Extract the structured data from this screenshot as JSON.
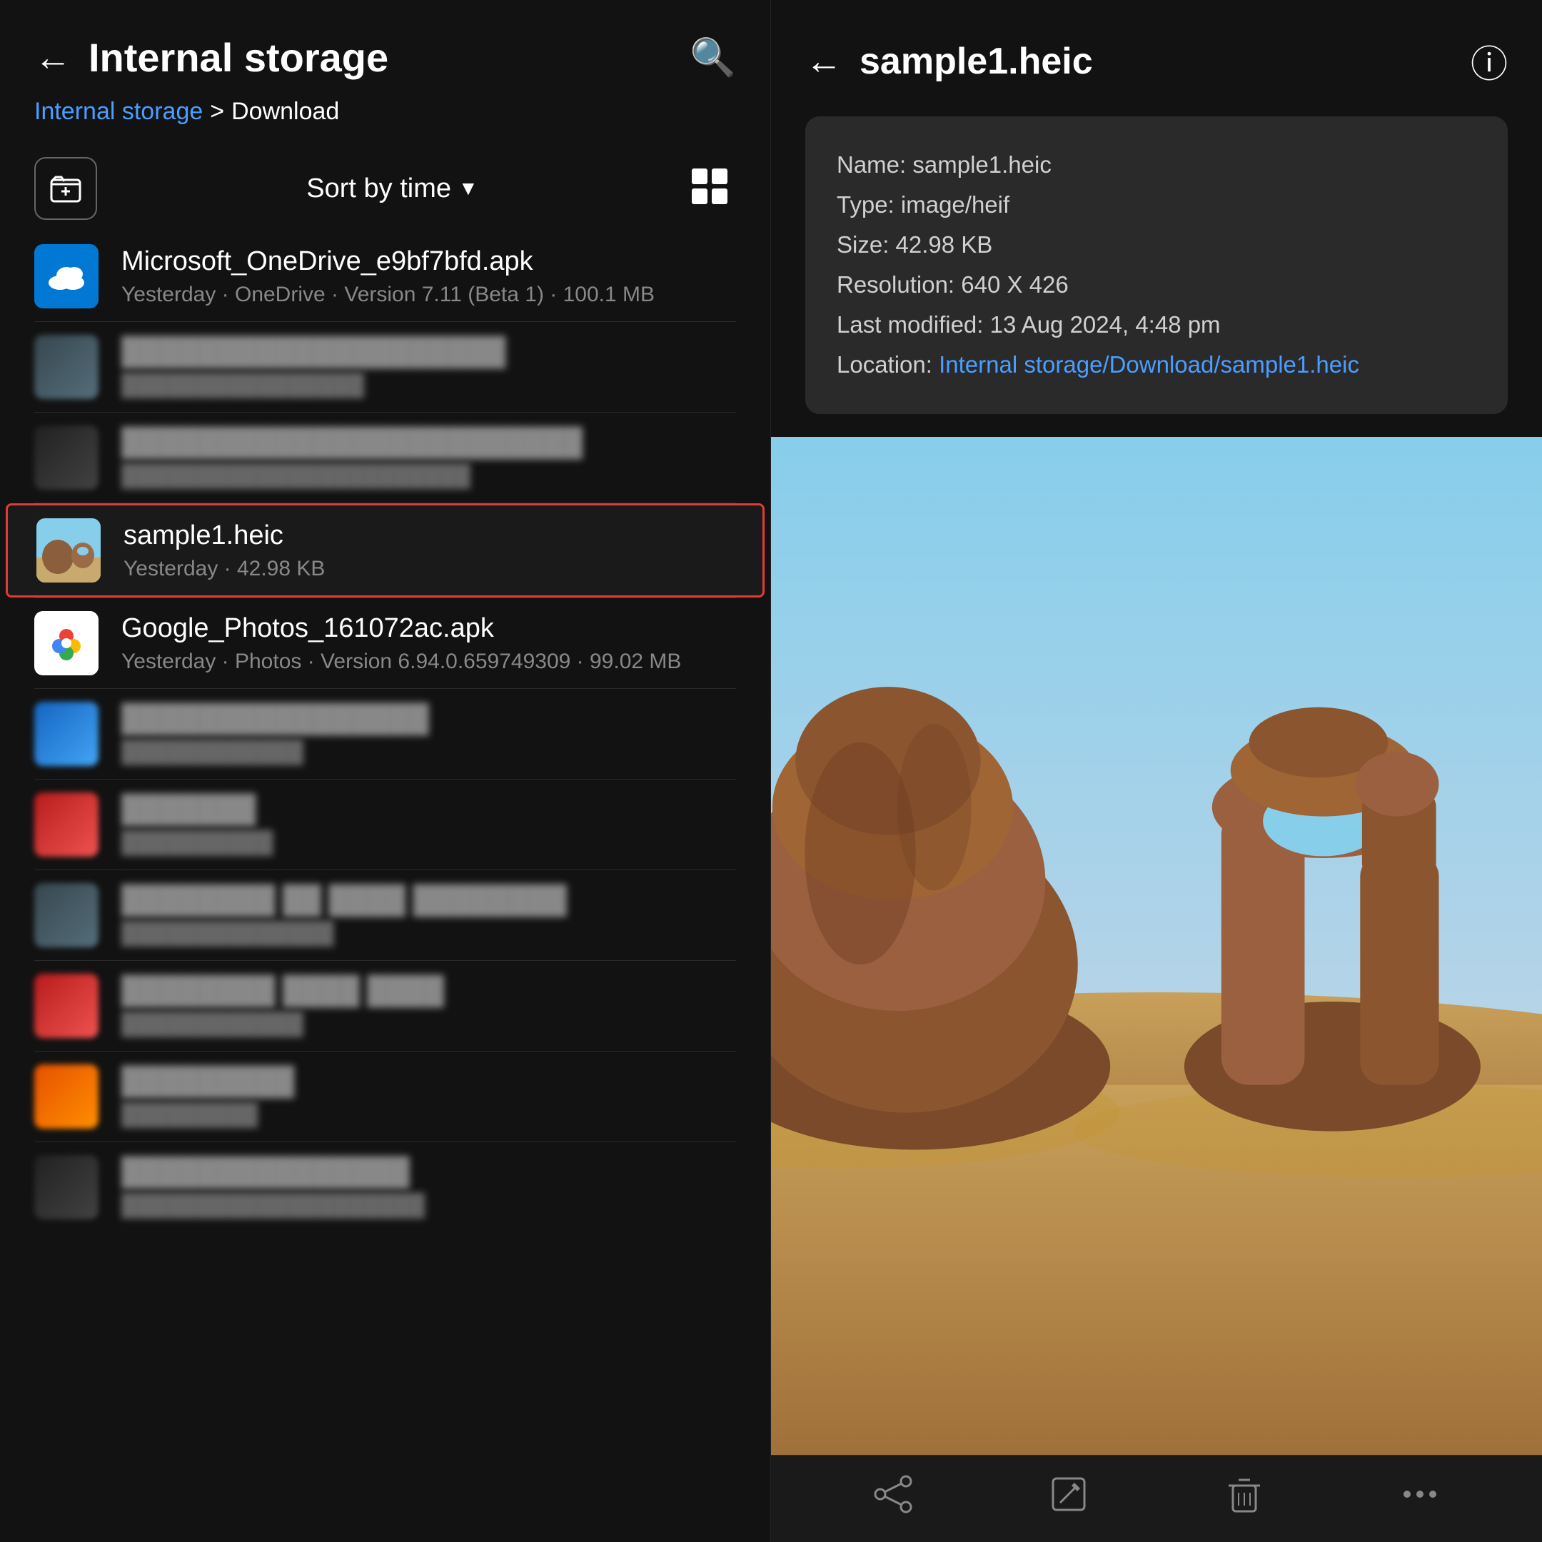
{
  "left": {
    "header": {
      "back_label": "←",
      "title": "Internal storage",
      "search_label": "🔍"
    },
    "breadcrumb": {
      "link_text": "Internal storage",
      "separator": ">",
      "current": "Download"
    },
    "toolbar": {
      "new_folder_label": "⊞",
      "sort_label": "Sort by time",
      "sort_arrow": "▼",
      "view_label": "⠿"
    },
    "files": [
      {
        "id": "onedrive",
        "name": "Microsoft_OneDrive_e9bf7bfd.apk",
        "meta": "Yesterday · OneDrive · Version 7.11 (Beta 1) · 100.1 MB",
        "type": "onedrive",
        "selected": false,
        "blurred": false
      },
      {
        "id": "blurred1",
        "name": "████████ ████ ████",
        "meta": "████████████████████",
        "type": "blurred",
        "selected": false,
        "blurred": true,
        "thumb_color": "thumb-mixed"
      },
      {
        "id": "blurred2",
        "name": "████████ ████████",
        "meta": "██████████████ ██████",
        "type": "blurred",
        "selected": false,
        "blurred": true,
        "thumb_color": "thumb-dark"
      },
      {
        "id": "sample1",
        "name": "sample1.heic",
        "meta": "Yesterday · 42.98 KB",
        "type": "image",
        "selected": true,
        "blurred": false
      },
      {
        "id": "gphotos",
        "name": "Google_Photos_161072ac.apk",
        "meta": "Yesterday · Photos · Version 6.94.0.659749309 · 99.02 MB",
        "type": "gphotos",
        "selected": false,
        "blurred": false
      },
      {
        "id": "blurred3",
        "name": "████ ████ ████",
        "meta": "████████████████████",
        "type": "blurred",
        "selected": false,
        "blurred": true,
        "thumb_color": "thumb-blue"
      },
      {
        "id": "blurred4",
        "name": "█████",
        "meta": "████████",
        "type": "blurred",
        "selected": false,
        "blurred": true,
        "thumb_color": "thumb-red"
      },
      {
        "id": "blurred5",
        "name": "████████ ██ ████ █████",
        "meta": "████████████████",
        "type": "blurred",
        "selected": false,
        "blurred": true,
        "thumb_color": "thumb-mixed"
      },
      {
        "id": "blurred6",
        "name": "████████ ████ ████",
        "meta": "████████████",
        "type": "blurred",
        "selected": false,
        "blurred": true,
        "thumb_color": "thumb-red"
      },
      {
        "id": "blurred7",
        "name": "████████",
        "meta": "████████",
        "type": "blurred",
        "selected": false,
        "blurred": true,
        "thumb_color": "thumb-orange"
      },
      {
        "id": "blurred8",
        "name": "████████ ████",
        "meta": "████████████████████",
        "type": "blurred",
        "selected": false,
        "blurred": true,
        "thumb_color": "thumb-dark"
      }
    ]
  },
  "right": {
    "header": {
      "back_label": "←",
      "title": "sample1.heic",
      "info_label": "ⓘ"
    },
    "info": {
      "name_label": "Name:",
      "name_value": "sample1.heic",
      "type_label": "Type:",
      "type_value": "image/heif",
      "size_label": "Size:",
      "size_value": "42.98 KB",
      "resolution_label": "Resolution:",
      "resolution_value": "640 X 426",
      "modified_label": "Last modified:",
      "modified_value": "13 Aug 2024, 4:48 pm",
      "location_label": "Location:",
      "location_value": "Internal storage/Download/sample1.heic"
    },
    "bottom_bar": {
      "share_icon": "↗",
      "edit_icon": "✏",
      "delete_icon": "🗑",
      "more_icon": "⋮"
    }
  }
}
